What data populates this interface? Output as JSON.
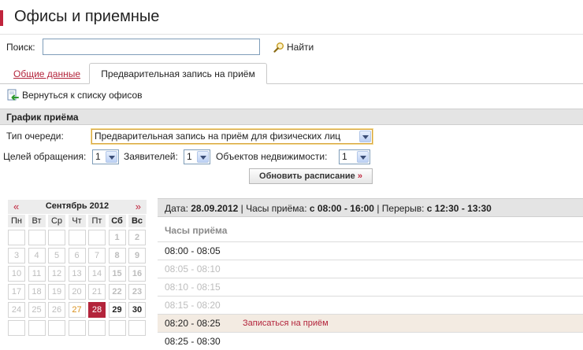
{
  "page": {
    "title": "Офисы и приемные"
  },
  "search": {
    "label": "Поиск:",
    "value": "",
    "button_label": "Найти"
  },
  "tabs": [
    {
      "label": "Общие данные",
      "active": false
    },
    {
      "label": "Предварительная запись на приём",
      "active": true
    }
  ],
  "back_link": {
    "label": "Вернуться к списку офисов"
  },
  "schedule_section": {
    "title": "График приёма"
  },
  "form": {
    "queue_type_label": "Тип очереди:",
    "queue_type_value": "Предварительная запись на приём для физических лиц",
    "goals_label": "Целей обращения:",
    "goals_value": "1",
    "applicants_label": "Заявителей:",
    "applicants_value": "1",
    "properties_label": "Объектов недвижимости:",
    "properties_value": "1",
    "refresh_label": "Обновить расписание",
    "refresh_suffix": "»"
  },
  "calendar": {
    "prev": "«",
    "next": "»",
    "month_label": "Сентябрь 2012",
    "weekdays": [
      "Пн",
      "Вт",
      "Ср",
      "Чт",
      "Пт",
      "Сб",
      "Вс"
    ],
    "weeks": [
      [
        "",
        "",
        "",
        "",
        "",
        "1",
        "2"
      ],
      [
        "3",
        "4",
        "5",
        "6",
        "7",
        "8",
        "9"
      ],
      [
        "10",
        "11",
        "12",
        "13",
        "14",
        "15",
        "16"
      ],
      [
        "17",
        "18",
        "19",
        "20",
        "21",
        "22",
        "23"
      ],
      [
        "24",
        "25",
        "26",
        "27",
        "28",
        "29",
        "30"
      ],
      [
        "",
        "",
        "",
        "",
        "",
        "",
        ""
      ]
    ],
    "today": "27",
    "selected": "28",
    "available": [
      "29",
      "30"
    ],
    "colors": {
      "accent": "#b3243b",
      "today": "#d9901c"
    }
  },
  "schedule": {
    "header": {
      "date_label": "Дата:",
      "date_value": "28.09.2012",
      "hours_label": "Часы приёма:",
      "hours_value": "с 08:00 - 16:00",
      "break_label": "Перерыв:",
      "break_value": "с 12:30 - 13:30",
      "separator": "|"
    },
    "subheader": "Часы приёма",
    "book_label": "Записаться на приём",
    "slots": [
      {
        "time": "08:00 - 08:05",
        "available": true,
        "highlight": false
      },
      {
        "time": "08:05 - 08:10",
        "available": false,
        "highlight": false
      },
      {
        "time": "08:10 - 08:15",
        "available": false,
        "highlight": false
      },
      {
        "time": "08:15 - 08:20",
        "available": false,
        "highlight": false
      },
      {
        "time": "08:20 - 08:25",
        "available": true,
        "highlight": true
      },
      {
        "time": "08:25 - 08:30",
        "available": true,
        "highlight": false
      }
    ]
  }
}
